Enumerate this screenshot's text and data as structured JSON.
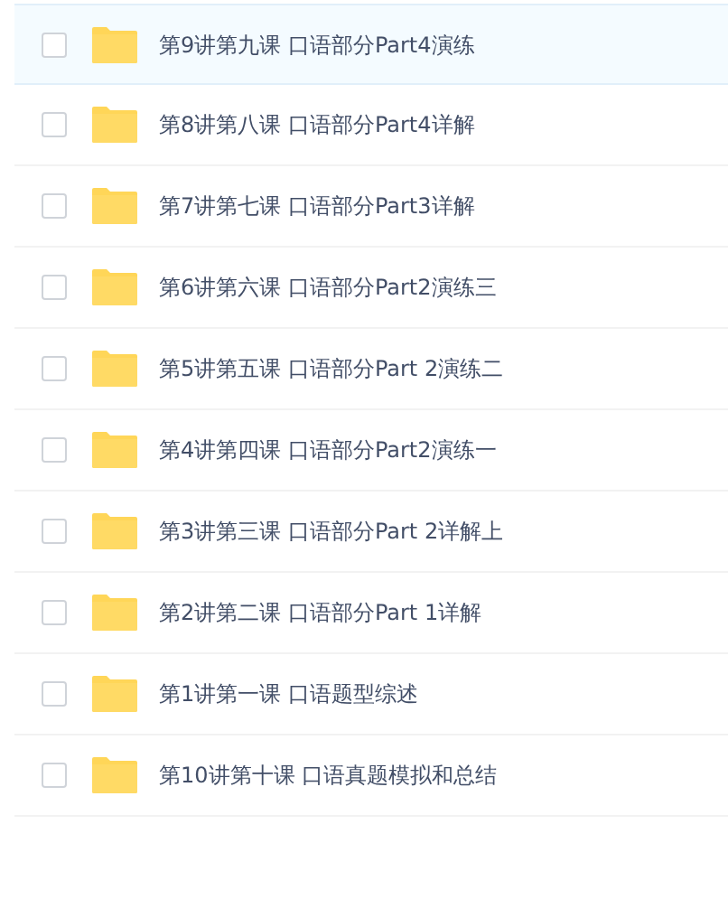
{
  "files": [
    {
      "name": "第9讲第九课 口语部分Part4演练",
      "selected": true,
      "checked": false
    },
    {
      "name": "第8讲第八课 口语部分Part4详解",
      "selected": false,
      "checked": false
    },
    {
      "name": "第7讲第七课 口语部分Part3详解",
      "selected": false,
      "checked": false
    },
    {
      "name": "第6讲第六课 口语部分Part2演练三",
      "selected": false,
      "checked": false
    },
    {
      "name": "第5讲第五课 口语部分Part 2演练二",
      "selected": false,
      "checked": false
    },
    {
      "name": "第4讲第四课 口语部分Part2演练一",
      "selected": false,
      "checked": false
    },
    {
      "name": "第3讲第三课 口语部分Part 2详解上",
      "selected": false,
      "checked": false
    },
    {
      "name": "第2讲第二课 口语部分Part 1详解",
      "selected": false,
      "checked": false
    },
    {
      "name": "第1讲第一课 口语题型综述",
      "selected": false,
      "checked": false
    },
    {
      "name": "第10讲第十课 口语真题模拟和总结",
      "selected": false,
      "checked": false
    }
  ]
}
